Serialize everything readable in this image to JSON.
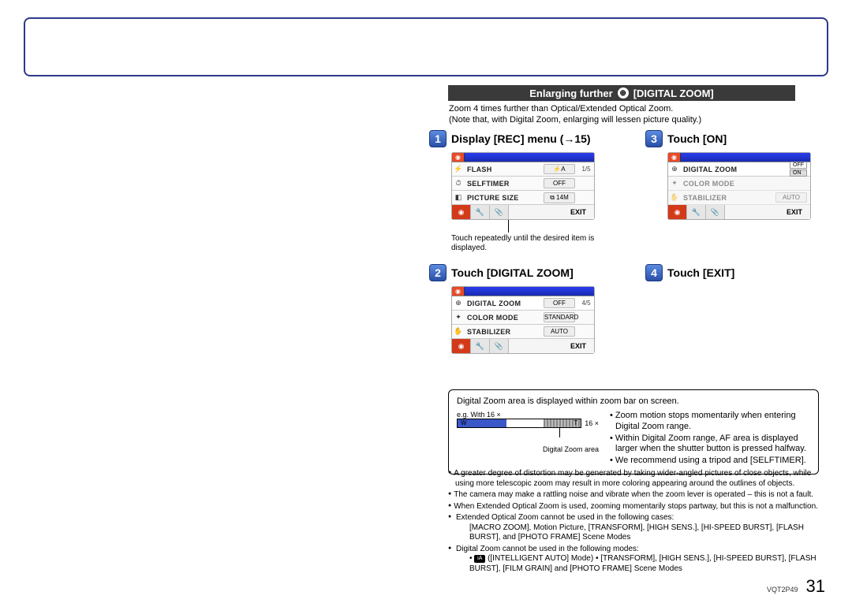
{
  "section": {
    "title_prefix": "Enlarging further",
    "title_suffix": "[DIGITAL ZOOM]"
  },
  "intro": {
    "line1": "Zoom 4 times further than Optical/Extended Optical Zoom.",
    "line2": "(Note that, with Digital Zoom, enlarging will lessen picture quality.)"
  },
  "steps": {
    "s1": {
      "num": "1",
      "title": "Display [REC] menu (→15)"
    },
    "s2": {
      "num": "2",
      "title": "Touch [DIGITAL ZOOM]"
    },
    "s3": {
      "num": "3",
      "title": "Touch [ON]"
    },
    "s4": {
      "num": "4",
      "title": "Touch [EXIT]"
    }
  },
  "shot1": {
    "page": "1/5",
    "rows": [
      {
        "icon": "⚡",
        "label": "FLASH",
        "val": "⚡A"
      },
      {
        "icon": "⏱",
        "label": "SELFTIMER",
        "val": "OFF"
      },
      {
        "icon": "◧",
        "label": "PICTURE SIZE",
        "val": "⧉ 14M"
      }
    ],
    "exit": "EXIT",
    "caption": "Touch repeatedly until the desired item is displayed."
  },
  "shot2": {
    "page": "4/5",
    "rows": [
      {
        "icon": "⊕",
        "label": "DIGITAL ZOOM",
        "val": "OFF"
      },
      {
        "icon": "✦",
        "label": "COLOR MODE",
        "val": "STANDARD"
      },
      {
        "icon": "✋",
        "label": "STABILIZER",
        "val": "AUTO"
      }
    ],
    "exit": "EXIT"
  },
  "shot3": {
    "rows": [
      {
        "icon": "⊕",
        "label": "DIGITAL ZOOM",
        "off": "OFF",
        "on": "ON"
      },
      {
        "icon": "✦",
        "label": "COLOR MODE",
        "val": ""
      },
      {
        "icon": "✋",
        "label": "STABILIZER",
        "val": "AUTO"
      }
    ],
    "exit": "EXIT"
  },
  "infobox": {
    "head": "Digital Zoom area is displayed within zoom bar on screen.",
    "eg": "e.g. With 16 ×",
    "w": "W",
    "t": "T",
    "mult": "16 ×",
    "dz_area": "Digital Zoom area",
    "b1": "• Zoom motion stops momentarily when entering Digital Zoom range.",
    "b2": "• Within Digital Zoom range, AF area is displayed larger when the shutter button is pressed halfway.",
    "b3": "• We recommend using a tripod and [SELFTIMER]."
  },
  "notes": {
    "n1": "A greater degree of distortion may be generated by taking wider-angled pictures of close objects, while using more telescopic zoom may result in more coloring appearing around the outlines of objects.",
    "n2": "The camera may make a rattling noise and vibrate when the zoom lever is operated – this is not a fault.",
    "n3": "When Extended Optical Zoom is used, zooming momentarily stops partway, but this is not a malfunction.",
    "n4": "Extended Optical Zoom cannot be used in the following cases:",
    "n4sub": "[MACRO ZOOM], Motion Picture, [TRANSFORM], [HIGH SENS.], [HI-SPEED BURST], [FLASH BURST], and [PHOTO FRAME] Scene Modes",
    "n5": "Digital Zoom cannot be used in the following modes:",
    "n5sub_a": "([INTELLIGENT AUTO] Mode)   • [TRANSFORM], [HIGH SENS.], [HI-SPEED BURST], [FLASH BURST], [FILM GRAIN] and [PHOTO FRAME] Scene Modes"
  },
  "footer": {
    "doc_id": "VQT2P49",
    "page": "31"
  }
}
